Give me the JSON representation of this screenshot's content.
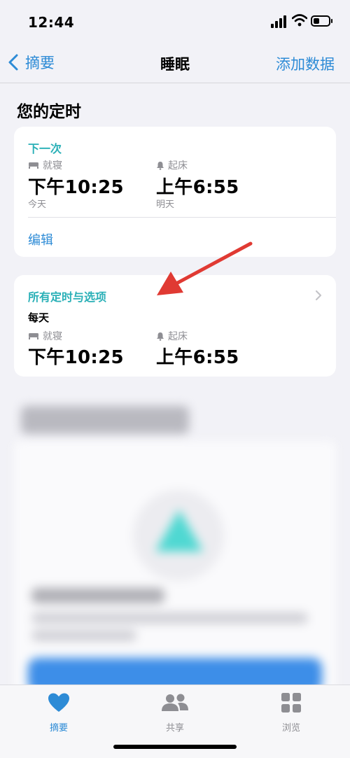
{
  "status_bar": {
    "time": "12:44"
  },
  "nav": {
    "back_label": "摘要",
    "title": "睡眠",
    "action_label": "添加数据"
  },
  "section": {
    "title": "您的定时"
  },
  "next_card": {
    "header": "下一次",
    "bedtime_label": "就寝",
    "bedtime": "下午10:25",
    "bedtime_day": "今天",
    "wake_label": "起床",
    "wake": "上午6:55",
    "wake_day": "明天",
    "edit_label": "编辑"
  },
  "all_card": {
    "header": "所有定时与选项",
    "frequency": "每天",
    "bedtime_label": "就寝",
    "bedtime": "下午10:25",
    "wake_label": "起床",
    "wake": "上午6:55"
  },
  "tabs": [
    {
      "label": "摘要",
      "icon": "heart-icon",
      "active": true
    },
    {
      "label": "共享",
      "icon": "people-icon",
      "active": false
    },
    {
      "label": "浏览",
      "icon": "grid-icon",
      "active": false
    }
  ],
  "colors": {
    "accent": "#2d8bd6",
    "teal": "#2ab0b7",
    "arrow": "#e03a33"
  },
  "battery_level": 0.35
}
